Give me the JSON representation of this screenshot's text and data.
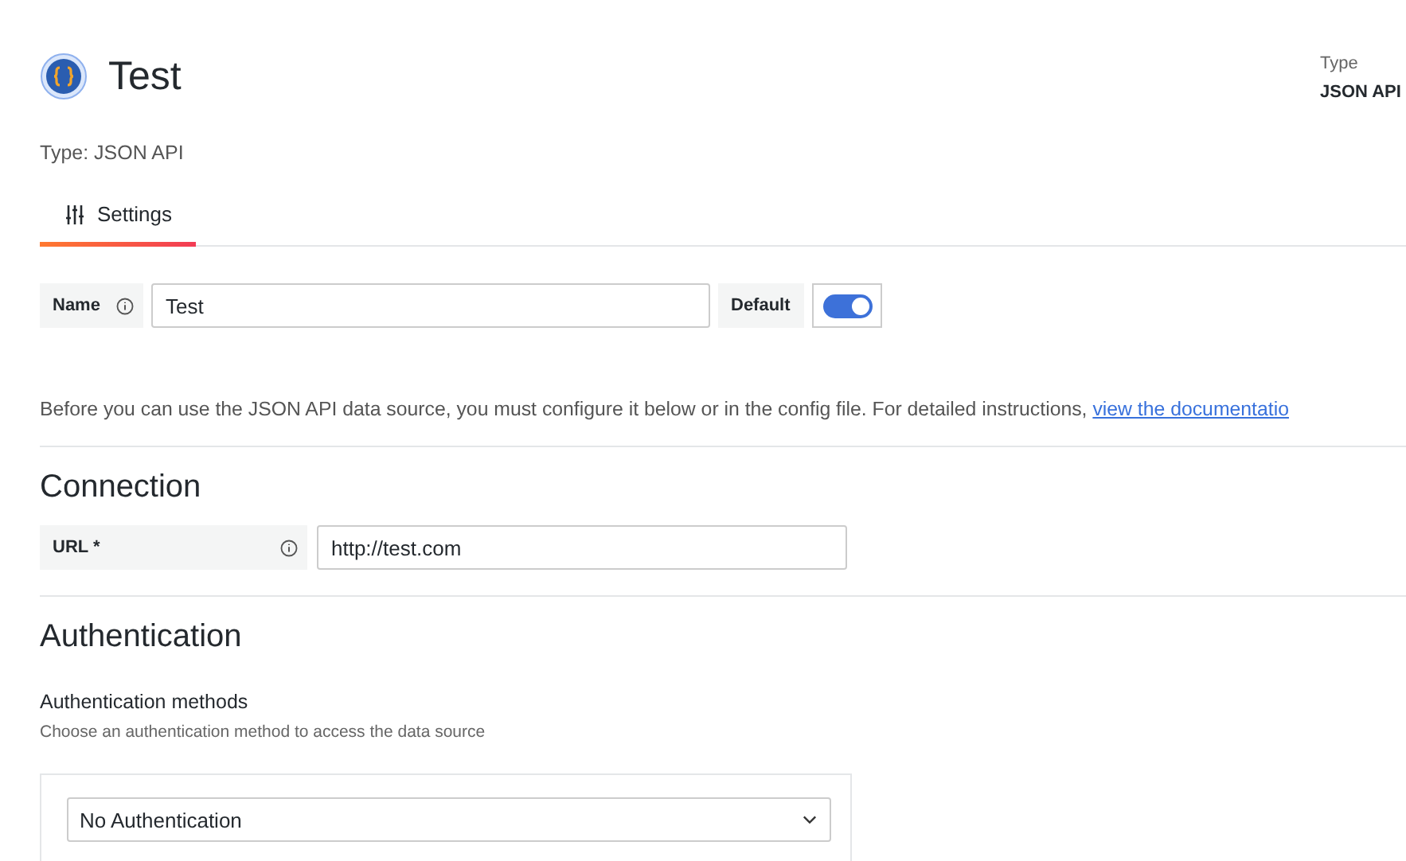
{
  "header": {
    "title": "Test",
    "type_label": "Type",
    "type_value": "JSON API",
    "subtitle": "Type: JSON API"
  },
  "tabs": [
    {
      "label": "Settings",
      "selected": true
    }
  ],
  "name_row": {
    "label": "Name",
    "value": "Test",
    "default_label": "Default",
    "default_on": true
  },
  "intro": {
    "text": "Before you can use the JSON API data source, you must configure it below or in the config file. For detailed instructions, ",
    "link": "view the documentatio"
  },
  "connection": {
    "heading": "Connection",
    "url_label": "URL *",
    "url_value": "http://test.com"
  },
  "authentication": {
    "heading": "Authentication",
    "methods_label": "Authentication methods",
    "methods_description": "Choose an authentication method to access the data source",
    "method": "No Authentication"
  }
}
